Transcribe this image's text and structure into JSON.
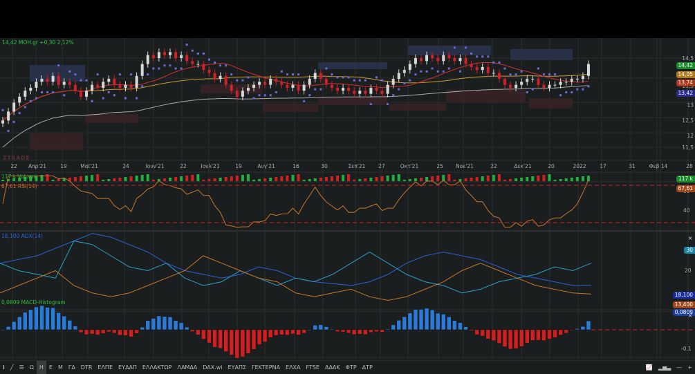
{
  "header": {
    "quote": "14,42 MOH.gr +0,30 2,12%",
    "watermark": "ZTRADE"
  },
  "panels": {
    "volume": "117 k Volume",
    "rsi": "67,61 RSI(14)",
    "adx": "18,100 ADX(14)",
    "macd": "0,0809 MACD-Histogram"
  },
  "price_axis": {
    "ticks": [
      "14,5",
      "13,5",
      "13",
      "12,5",
      "12",
      "11,5"
    ],
    "tags": [
      {
        "v": "14,42",
        "c": "#1a8a2a"
      },
      {
        "v": "14,05",
        "c": "#b07a1a"
      },
      {
        "v": "13,74",
        "c": "#b0361a"
      },
      {
        "v": "13,42",
        "c": "#2a2a8a"
      }
    ]
  },
  "rsi_axis": {
    "ticks": [
      "60",
      "40"
    ],
    "tag": "67,61",
    "vol_tag": "117 k"
  },
  "adx_axis": {
    "ticks": [
      "30",
      "20"
    ],
    "tags": [
      {
        "v": "30",
        "c": "#1a88aa"
      },
      {
        "v": "18,100",
        "c": "#1a2aa0"
      },
      {
        "v": "13,400",
        "c": "#a0481a"
      }
    ]
  },
  "macd_axis": {
    "ticks": [
      "-0,1"
    ],
    "tag": "0,0809"
  },
  "close_icon": "×",
  "dates": [
    "22",
    "Απρ'21",
    "19",
    "Μαϊ'21",
    "24",
    "Ιουν'21",
    "22",
    "Ιουλ'21",
    "19",
    "Αυγ'21",
    "16",
    "30",
    "Σεπ'21",
    "27",
    "Οκτ'21",
    "25",
    "Νοε'21",
    "22",
    "Δεκ'21",
    "20",
    "2022",
    "17",
    "31",
    "Φεβ 14",
    "28"
  ],
  "toolbar": {
    "items": [
      "Ω",
      "Η",
      "Ε",
      "Μ",
      "ΓΔ",
      "DTR",
      "ΕΛΠΕ",
      "ΕΥΔΑΠ",
      "ΕΛΛΑΚΤΩΡ",
      "ΛΑΜΔΑ",
      "DAX.wi",
      "ΕΥΑΠΣ",
      "ΓΕΚΤΕΡΝΑ",
      "ΕΛΧΑ",
      "FTSE",
      "ΑΔΑΚ",
      "ΦΤΡ",
      "ΔΤΡ"
    ],
    "active": "Η"
  },
  "colors": {
    "up": "#d8d8d8",
    "down": "#d0202a",
    "ma20": "#d03030",
    "ma50": "#c89a30",
    "ma100": "#aaaaaa",
    "sar": "#6a6ad8",
    "rsi": "#c8782a",
    "adx": "#2a60d8",
    "dip": "#2aa0c8",
    "dim": "#c8782a",
    "macd_up": "#2a7ad8",
    "macd_dn": "#d02020"
  },
  "chart_data": {
    "type": "candlestick",
    "symbol": "MOH.gr",
    "ylim": [
      11.3,
      14.9
    ],
    "closes": [
      12.4,
      12.7,
      13.0,
      13.2,
      13.4,
      13.5,
      13.7,
      13.8,
      13.7,
      13.9,
      13.6,
      13.7,
      13.6,
      13.4,
      13.2,
      13.4,
      13.6,
      13.5,
      13.7,
      13.8,
      13.6,
      13.5,
      13.6,
      13.5,
      13.9,
      14.3,
      14.6,
      14.5,
      14.7,
      14.6,
      14.7,
      14.5,
      14.6,
      14.4,
      14.3,
      14.3,
      14.1,
      14.0,
      13.8,
      13.9,
      13.6,
      13.4,
      13.2,
      13.4,
      13.5,
      13.6,
      13.7,
      13.6,
      13.8,
      13.7,
      13.6,
      13.5,
      13.6,
      13.4,
      13.6,
      13.8,
      14.0,
      13.8,
      13.6,
      13.5,
      13.4,
      13.5,
      13.4,
      13.3,
      13.4,
      13.3,
      13.5,
      13.4,
      13.3,
      13.6,
      13.8,
      14.0,
      14.1,
      14.3,
      14.5,
      14.4,
      14.6,
      14.5,
      14.4,
      14.6,
      14.5,
      14.4,
      14.5,
      14.3,
      14.2,
      14.1,
      14.2,
      14.0,
      14.0,
      13.8,
      13.6,
      13.5,
      13.6,
      13.7,
      13.8,
      13.8,
      13.6,
      13.5,
      13.6,
      13.6,
      13.7,
      13.7,
      13.8,
      13.8,
      13.9,
      14.3
    ],
    "adx": [
      30,
      32,
      34,
      38,
      42,
      46,
      44,
      40,
      36,
      30,
      26,
      24,
      22,
      24,
      28,
      26,
      22,
      20,
      19,
      18,
      20,
      24,
      30,
      34,
      36,
      34,
      32,
      28,
      24,
      22,
      20,
      18,
      18.1
    ],
    "di_plus": [
      30,
      26,
      24,
      22,
      42,
      40,
      34,
      28,
      26,
      30,
      22,
      18,
      20,
      26,
      22,
      18,
      22,
      20,
      24,
      30,
      36,
      30,
      24,
      20,
      18,
      14,
      16,
      20,
      22,
      24,
      28,
      26,
      30
    ],
    "di_minus": [
      14,
      18,
      22,
      26,
      18,
      14,
      12,
      14,
      18,
      22,
      26,
      34,
      30,
      26,
      22,
      20,
      14,
      12,
      14,
      16,
      12,
      10,
      12,
      16,
      20,
      26,
      30,
      26,
      22,
      18,
      16,
      14,
      13.4
    ]
  }
}
